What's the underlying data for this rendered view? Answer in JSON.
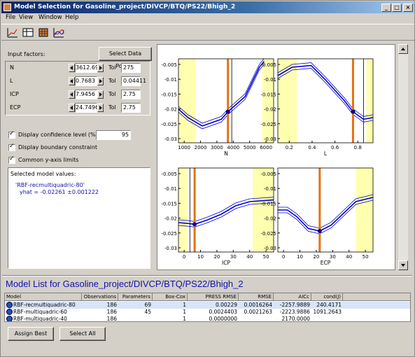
{
  "window": {
    "title": "Model Selection for Gasoline_project/DIVCP/BTQ/PS22/Bhigh_2",
    "controls": [
      "_",
      "□",
      "×"
    ]
  },
  "menu": [
    "File",
    "View",
    "Window",
    "Help"
  ],
  "toolbar": {
    "icons": [
      "response-curve-icon",
      "table-icon",
      "surface-icon",
      "comparison-icon"
    ]
  },
  "left": {
    "input_factors_label": "Input factors:",
    "select_point_button": "Select Data Point...",
    "tol_label": "Tol",
    "factors": [
      {
        "name": "N",
        "value": "3612.69",
        "tol": "275"
      },
      {
        "name": "L",
        "value": "0.7683",
        "tol": "0.04411"
      },
      {
        "name": "ICP",
        "value": "7.9456",
        "tol": "2.75"
      },
      {
        "name": "ECP",
        "value": "24.7496",
        "tol": "2.75"
      }
    ],
    "confidence_label": "Display confidence level (%):",
    "confidence_value": "95",
    "boundary_label": "Display boundary constraint",
    "yaxis_label": "Common y-axis limits",
    "selected_title": "Selected model values:",
    "selected_model": "'RBF-recmultiquadric-80'",
    "yhat": "yhat = -0.02261 ±0.001222"
  },
  "plots": [
    {
      "xlabel": "N",
      "xticks": [
        "1000",
        "2000",
        "3000",
        "4000",
        "5000",
        "6000"
      ],
      "yticks": [
        "-0.005",
        "-0.01",
        "-0.015",
        "-0.02",
        "-0.025",
        "-0.03"
      ]
    },
    {
      "xlabel": "L",
      "xticks": [
        "0.2",
        "0.4",
        "0.6",
        "0.8"
      ],
      "yticks": [
        "-0.005",
        "-0.01",
        "-0.015",
        "-0.02",
        "-0.025",
        "-0.03"
      ]
    },
    {
      "xlabel": "ICP",
      "xticks": [
        "0",
        "10",
        "20",
        "30",
        "40",
        "50"
      ],
      "yticks": [
        "-0.005",
        "-0.01",
        "-0.015",
        "-0.02",
        "-0.025",
        "-0.03"
      ]
    },
    {
      "xlabel": "ECP",
      "xticks": [
        "0",
        "10",
        "20",
        "30",
        "40",
        "50"
      ],
      "yticks": [
        "-0.005",
        "-0.01",
        "-0.015",
        "-0.02",
        "-0.025",
        "-0.03"
      ]
    }
  ],
  "model_list": {
    "title": "Model List for Gasoline_project/DIVCP/BTQ/PS22/Bhigh_2",
    "columns": [
      "Model",
      "Observations",
      "Parameters",
      "Box-Cox",
      "PRESS RMSE",
      "RMSE",
      "AICc",
      "cond(J)"
    ],
    "rows": [
      [
        "RBF-recmultiquadric-80",
        "186",
        "69",
        "1",
        "0.00229",
        "0.0016264",
        "-2257.9889",
        "240.4171"
      ],
      [
        "RBF-multiquadric-60",
        "186",
        "45",
        "1",
        "0.0024403",
        "0.0021263",
        "-2223.9886",
        "1091.2643"
      ],
      [
        "RBF-multiquadric-40",
        "186",
        "",
        "1",
        "0.0000000",
        "",
        "2170.0000",
        ""
      ]
    ]
  },
  "buttons": {
    "assign_best": "Assign Best",
    "select_all": "Select All"
  },
  "colors": {
    "boundary_fill": "#ffffb0",
    "curve": "#0000cc",
    "marker_line": "#e87010",
    "title_blue": "#1010b0"
  }
}
